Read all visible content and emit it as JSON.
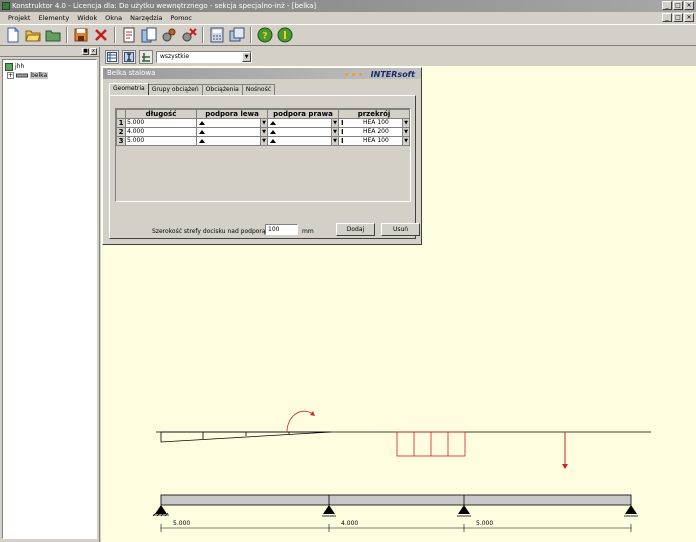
{
  "window": {
    "title": "Konstruktor 4.0 - Licencja dla: Do użytku wewnętrznego - sekcja specjalno-inż - [belka]",
    "btn_min": "_",
    "btn_max": "□",
    "btn_close": "✕"
  },
  "menu": {
    "items": [
      "Projekt",
      "Elementy",
      "Widok",
      "Okna",
      "Narzędzia",
      "Pomoc"
    ]
  },
  "left_panel": {
    "tree": {
      "root": "jhh",
      "child": "belka",
      "expander": "+"
    }
  },
  "subbar": {
    "combo_value": "wszystkie",
    "combo_arrow": "▼"
  },
  "dialog": {
    "title": "Belka stalowa",
    "brand": "INTERsoft",
    "tabs": [
      "Geometria",
      "Grupy obciążeń",
      "Obciążenia",
      "Nośność"
    ],
    "table": {
      "headers": [
        "długość",
        "podpora lewa",
        "podpora prawa",
        "przekrój"
      ],
      "rows": [
        {
          "n": "1",
          "length": "5.000",
          "section": "HEA 100"
        },
        {
          "n": "2",
          "length": "4.000",
          "section": "HEA 200"
        },
        {
          "n": "3",
          "length": "5.000",
          "section": "HEA 100"
        }
      ]
    },
    "width_label": "Szerokość strefy docisku nad podporą",
    "width_value": "100",
    "width_unit": "mm",
    "btn_add": "Dodaj",
    "btn_delete": "Usuń"
  },
  "beam": {
    "spans": [
      "5.000",
      "4.000",
      "5.000"
    ]
  },
  "colors": {
    "workspace_bg": "#fffde0",
    "load_red": "#d02020",
    "chrome": "#d4d0c8"
  }
}
